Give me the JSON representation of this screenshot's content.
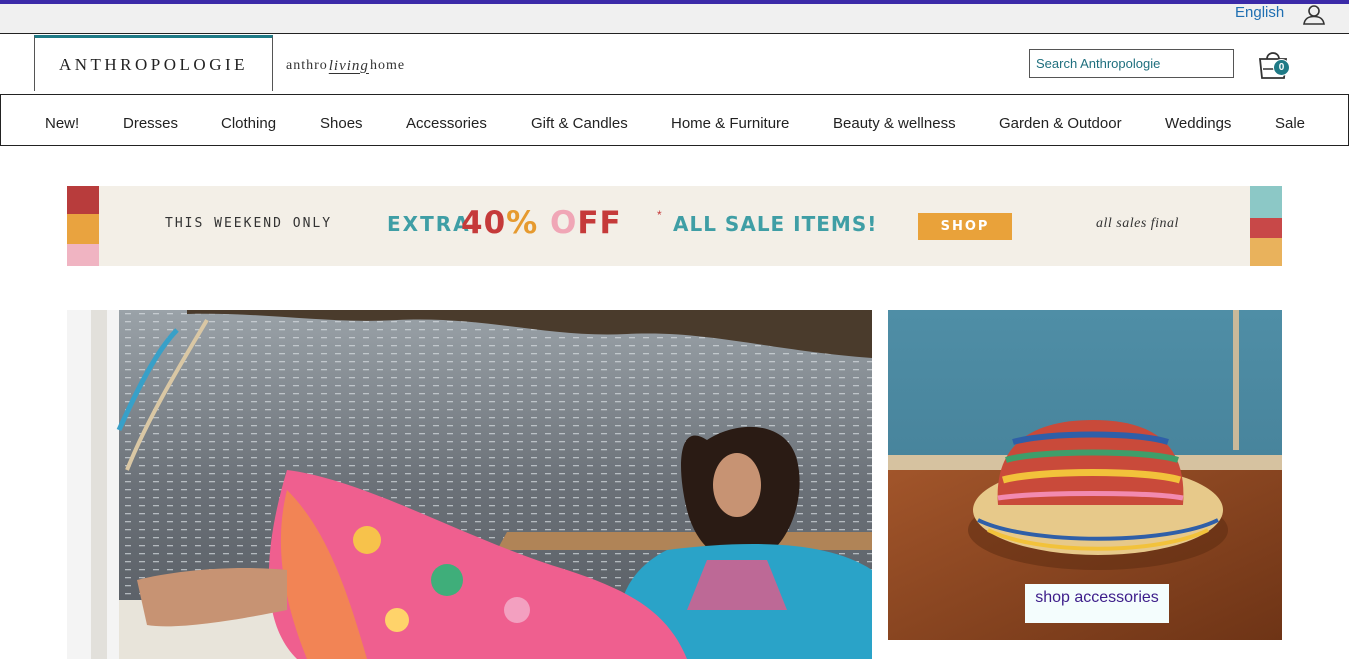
{
  "utility": {
    "language": "English",
    "account_icon": "user-icon"
  },
  "brand": {
    "logo": "ANTHROPOLOGIE",
    "living_logo": {
      "pre": "anthro",
      "script": "living",
      "post": "home"
    }
  },
  "search": {
    "placeholder": "Search Anthropologie",
    "icon": "search-icon"
  },
  "cart": {
    "icon": "shopping-bag-icon",
    "count": "0"
  },
  "nav": {
    "items": [
      "New!",
      "Dresses",
      "Clothing",
      "Shoes",
      "Accessories",
      "Gift & Candles",
      "Home & Furniture",
      "Beauty & wellness",
      "Garden & Outdoor",
      "Weddings",
      "Sale"
    ]
  },
  "promo": {
    "weekend": "THIS WEEKEND ONLY",
    "extra": "EXTRA",
    "amount": "40",
    "percent": "%",
    "off_o": "O",
    "off_ff": "FF",
    "asterisk": "*",
    "items": "ALL SALE ITEMS!",
    "shop": "SHOP",
    "final": "all sales final",
    "colors": {
      "teal": "#3f9ea5",
      "red": "#c53a3a",
      "orange": "#e9a23a",
      "pink": "#f0a6b6"
    }
  },
  "hero": {
    "side_cta": "shop accessories"
  },
  "colors": {
    "accent_teal": "#1f7a86",
    "top_strip": "#3b2aa8",
    "link_blue": "#1f6fb2",
    "cta_text": "#3d1d8a"
  }
}
